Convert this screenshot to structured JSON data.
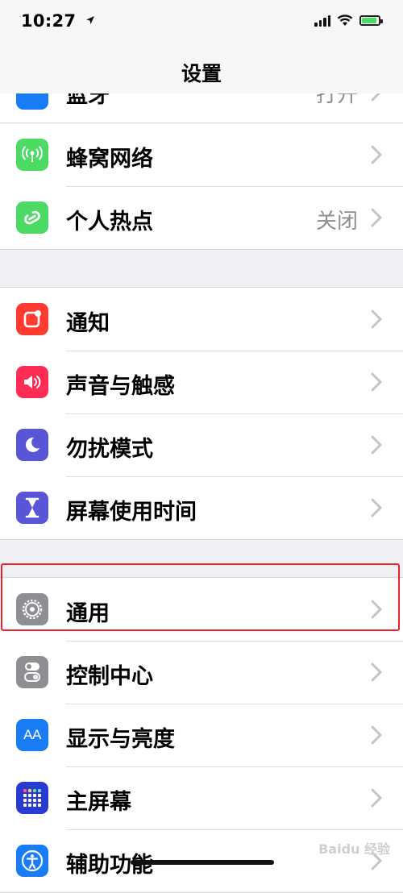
{
  "status_bar": {
    "time": "10:27"
  },
  "nav": {
    "title": "设置"
  },
  "clipped_row": {
    "label": "蓝牙",
    "value": "打开"
  },
  "groups": [
    {
      "items": [
        {
          "label": "蜂窝网络",
          "value": "",
          "icon": "cellular-icon",
          "color": "#4cd964"
        },
        {
          "label": "个人热点",
          "value": "关闭",
          "icon": "hotspot-icon",
          "color": "#4cd964"
        }
      ]
    },
    {
      "items": [
        {
          "label": "通知",
          "value": "",
          "icon": "notifications-icon",
          "color": "#ff3b30"
        },
        {
          "label": "声音与触感",
          "value": "",
          "icon": "sound-icon",
          "color": "#ff2d55"
        },
        {
          "label": "勿扰模式",
          "value": "",
          "icon": "moon-icon",
          "color": "#5856d6"
        },
        {
          "label": "屏幕使用时间",
          "value": "",
          "icon": "hourglass-icon",
          "color": "#5856d6"
        }
      ]
    },
    {
      "items": [
        {
          "label": "通用",
          "value": "",
          "icon": "gear-icon",
          "color": "#8e8e93"
        },
        {
          "label": "控制中心",
          "value": "",
          "icon": "toggles-icon",
          "color": "#8e8e93"
        },
        {
          "label": "显示与亮度",
          "value": "",
          "icon": "display-icon",
          "color": "#1a7cf5",
          "icon_text": "AA"
        },
        {
          "label": "主屏幕",
          "value": "",
          "icon": "home-screen-icon",
          "color": "#2a3bd1"
        },
        {
          "label": "辅助功能",
          "value": "",
          "icon": "accessibility-icon",
          "color": "#1a7cf5"
        }
      ]
    }
  ],
  "watermark": "Baidu 经验"
}
